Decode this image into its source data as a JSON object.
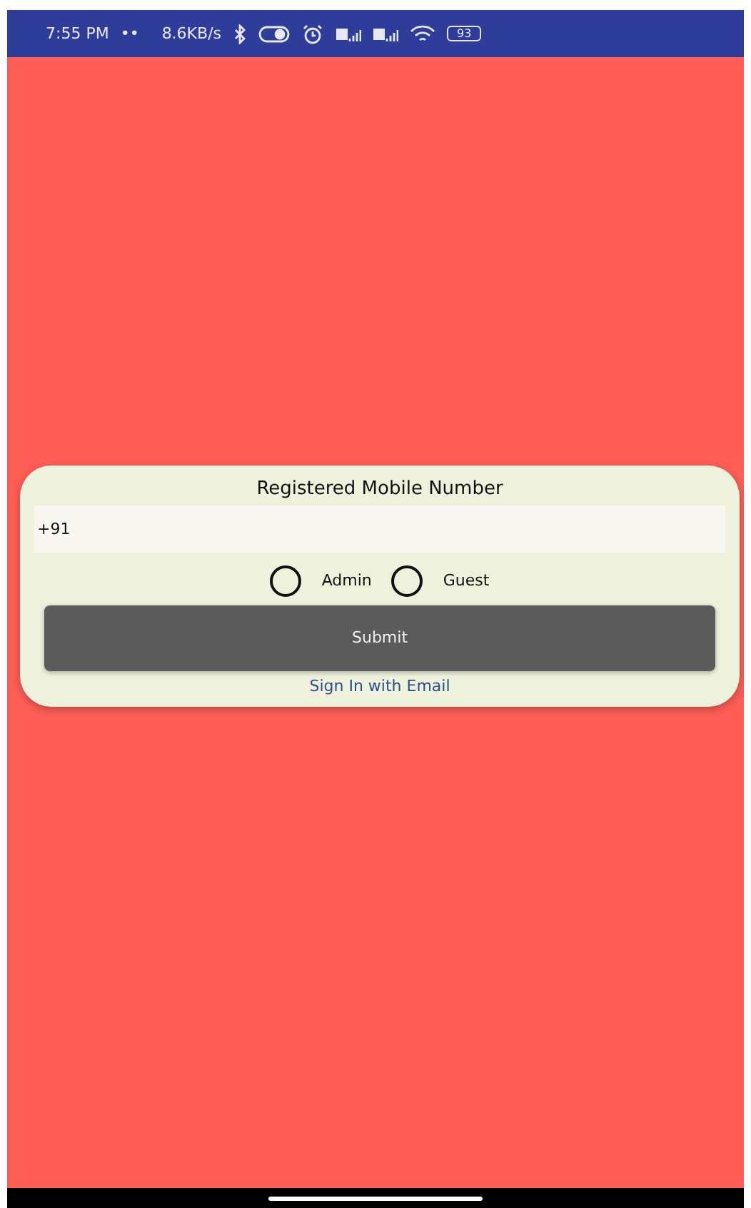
{
  "status_bar": {
    "time": "7:55 PM",
    "dots": "••",
    "speed": "8.6KB/s",
    "battery": "93"
  },
  "login_card": {
    "title": "Registered Mobile Number",
    "phone_field": {
      "value": "+91"
    },
    "roles": [
      {
        "label": "Admin",
        "selected": false
      },
      {
        "label": "Guest",
        "selected": false
      }
    ],
    "submit_button": "Submit",
    "link": "Sign In with Email"
  }
}
